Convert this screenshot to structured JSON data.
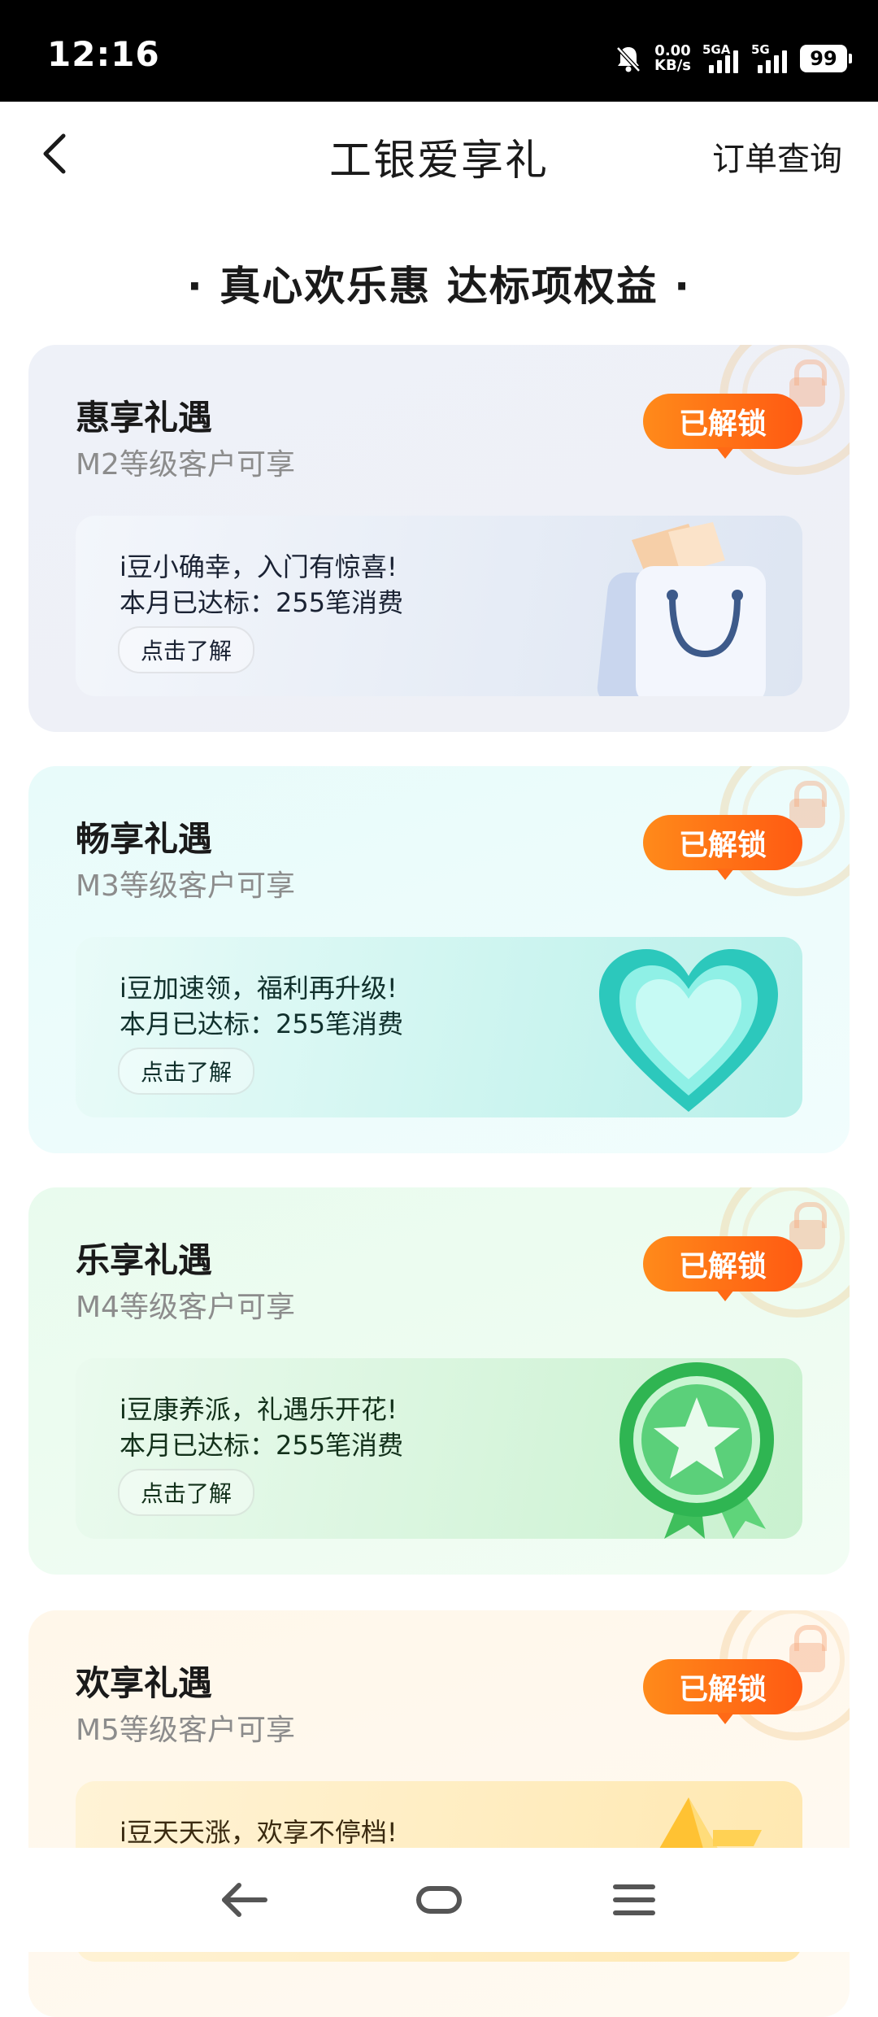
{
  "status_bar": {
    "time": "12:16",
    "net_speed_value": "0.00",
    "net_speed_unit": "KB/s",
    "sim1_label": "5GA",
    "sim2_label": "5G",
    "battery": "99",
    "icons": [
      "mute-bell-icon",
      "signal-icon",
      "battery-icon"
    ]
  },
  "header": {
    "title": "工银爱享礼",
    "right_link": "订单查询",
    "back_icon": "chevron-left-icon"
  },
  "section_heading": "· 真心欢乐惠 达标项权益 ·",
  "cards": [
    {
      "title": "惠享礼遇",
      "subtitle": "M2等级客户可享",
      "badge": "已解锁",
      "line1": "i豆小确幸，入门有惊喜!",
      "line2": "本月已达标：255笔消费",
      "button": "点击了解",
      "illustration": "shopping-bag-icon"
    },
    {
      "title": "畅享礼遇",
      "subtitle": "M3等级客户可享",
      "badge": "已解锁",
      "line1": "i豆加速领，福利再升级!",
      "line2": "本月已达标：255笔消费",
      "button": "点击了解",
      "illustration": "heart-icon"
    },
    {
      "title": "乐享礼遇",
      "subtitle": "M4等级客户可享",
      "badge": "已解锁",
      "line1": "i豆康养派，礼遇乐开花!",
      "line2": "本月已达标：255笔消费",
      "button": "点击了解",
      "illustration": "star-medal-icon"
    },
    {
      "title": "欢享礼遇",
      "subtitle": "M5等级客户可享",
      "badge": "已解锁",
      "line1": "i豆天天涨，欢享不停档!",
      "illustration": "trophy-icon"
    }
  ],
  "nav_bar": {
    "icons": [
      "back-arrow-icon",
      "home-icon",
      "menu-icon"
    ]
  },
  "colors": {
    "badge_start": "#ff8a1a",
    "badge_end": "#ff5a12",
    "status_bar_bg": "#000000"
  }
}
